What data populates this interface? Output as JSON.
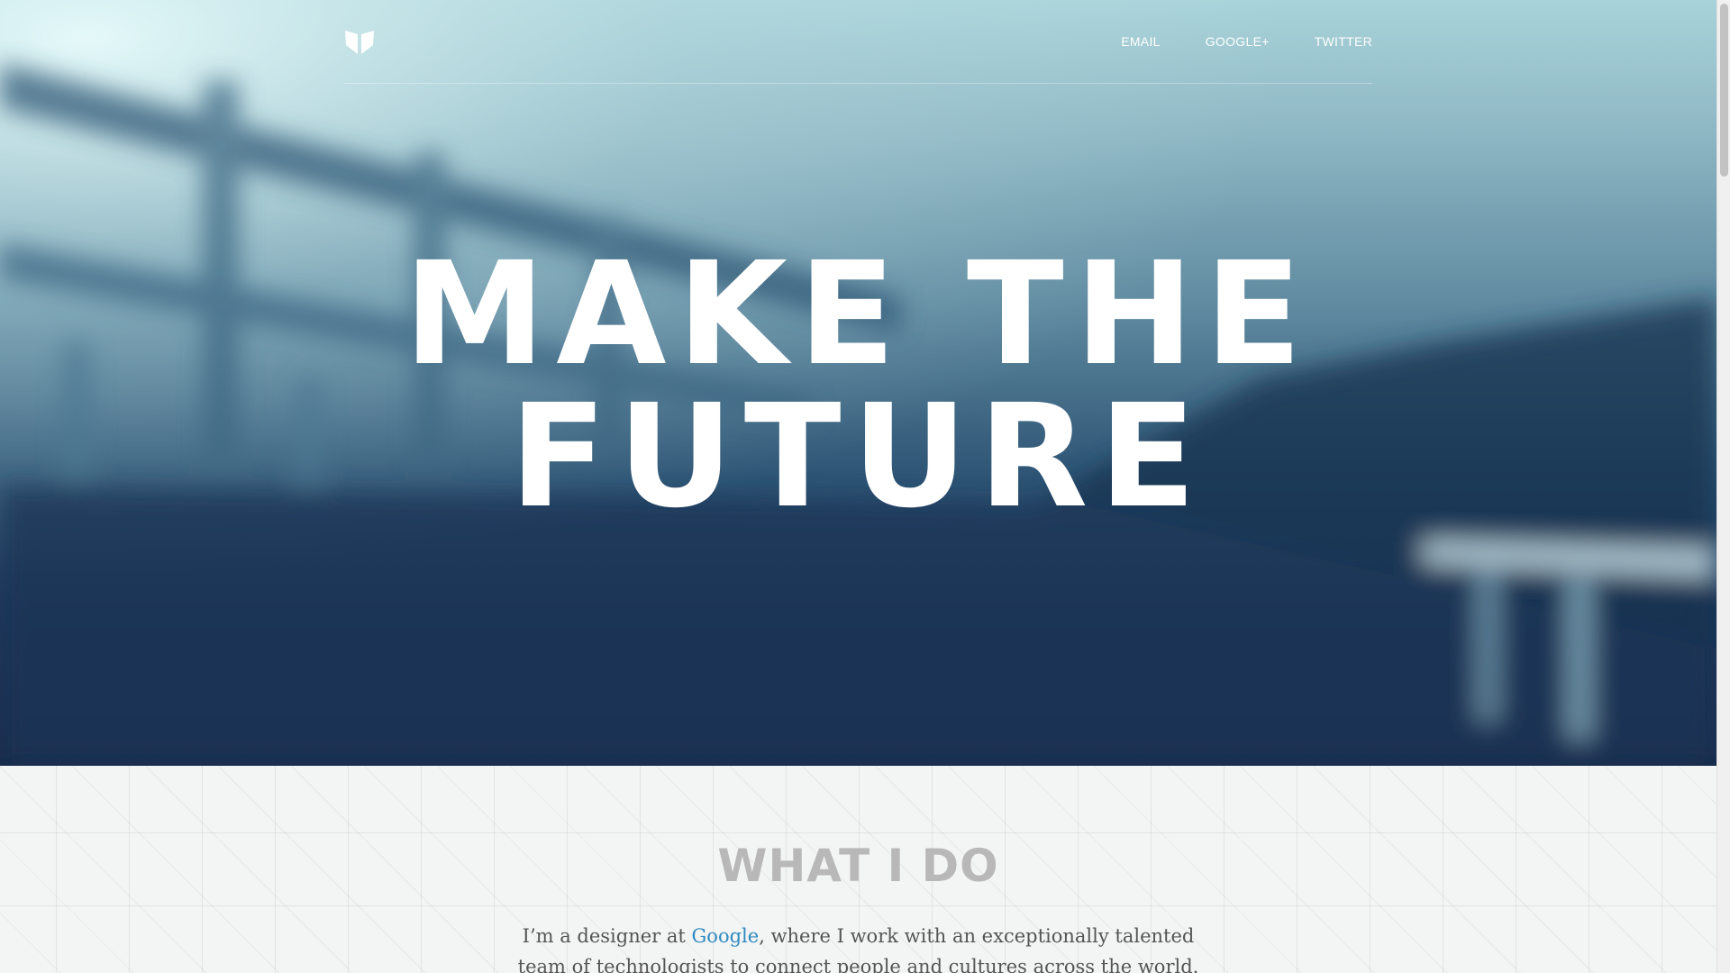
{
  "nav": {
    "links": [
      {
        "label": "EMAIL"
      },
      {
        "label": "GOOGLE+"
      },
      {
        "label": "TWITTER"
      }
    ]
  },
  "hero": {
    "headline_line1": "MAKE THE",
    "headline_line2": "FUTURE"
  },
  "about": {
    "title": "WHAT I DO",
    "text_before_link": "I’m a designer at ",
    "link_text": "Google",
    "text_after_link": ", where I work with an exceptionally talented team of technologists to connect people and cultures across the world. Previously, I"
  },
  "colors": {
    "link": "#2e8bc0",
    "heading_gray": "#b8b8b8",
    "hero_dark": "#16294a",
    "hero_light": "#a9d3da"
  },
  "icons": {
    "logo": "heart-shield-logo"
  }
}
